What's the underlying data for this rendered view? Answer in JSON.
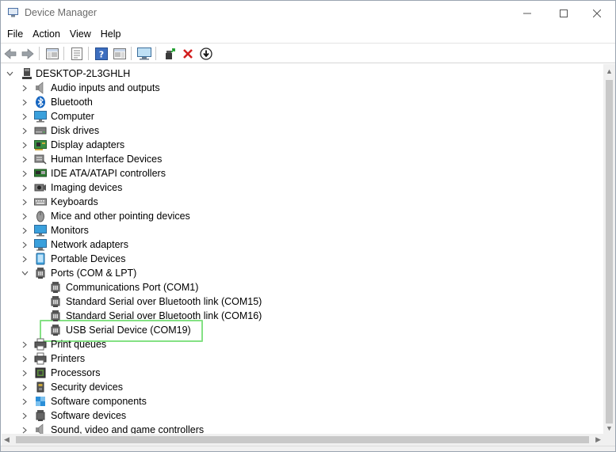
{
  "window": {
    "title": "Device Manager",
    "icon": "device-manager-icon"
  },
  "menu": [
    "File",
    "Action",
    "View",
    "Help"
  ],
  "toolbar": {
    "icons": [
      "back-arrow-icon",
      "forward-arrow-icon",
      "show-hide-console-tree-icon",
      "properties-icon",
      "help-icon",
      "action-pane-icon",
      "computer-monitor-icon",
      "update-driver-icon",
      "uninstall-device-icon",
      "disable-device-icon"
    ]
  },
  "tree": {
    "root": "DESKTOP-2L3GHLH",
    "categories": [
      {
        "label": "Audio inputs and outputs",
        "icon": "speaker-icon",
        "expanded": false
      },
      {
        "label": "Bluetooth",
        "icon": "bluetooth-icon",
        "expanded": false
      },
      {
        "label": "Computer",
        "icon": "computer-icon",
        "expanded": false
      },
      {
        "label": "Disk drives",
        "icon": "disk-drive-icon",
        "expanded": false
      },
      {
        "label": "Display adapters",
        "icon": "display-adapter-icon",
        "expanded": false
      },
      {
        "label": "Human Interface Devices",
        "icon": "hid-icon",
        "expanded": false
      },
      {
        "label": "IDE ATA/ATAPI controllers",
        "icon": "ide-controller-icon",
        "expanded": false
      },
      {
        "label": "Imaging devices",
        "icon": "camera-icon",
        "expanded": false
      },
      {
        "label": "Keyboards",
        "icon": "keyboard-icon",
        "expanded": false
      },
      {
        "label": "Mice and other pointing devices",
        "icon": "mouse-icon",
        "expanded": false
      },
      {
        "label": "Monitors",
        "icon": "monitor-icon",
        "expanded": false
      },
      {
        "label": "Network adapters",
        "icon": "network-adapter-icon",
        "expanded": false
      },
      {
        "label": "Portable Devices",
        "icon": "portable-device-icon",
        "expanded": false
      },
      {
        "label": "Ports (COM & LPT)",
        "icon": "port-icon",
        "expanded": true,
        "children": [
          "Communications Port (COM1)",
          "Standard Serial over Bluetooth link (COM15)",
          "Standard Serial over Bluetooth link (COM16)",
          "USB Serial Device (COM19)"
        ]
      },
      {
        "label": "Print queues",
        "icon": "printer-icon",
        "expanded": false
      },
      {
        "label": "Printers",
        "icon": "printer-icon",
        "expanded": false
      },
      {
        "label": "Processors",
        "icon": "processor-icon",
        "expanded": false
      },
      {
        "label": "Security devices",
        "icon": "security-device-icon",
        "expanded": false
      },
      {
        "label": "Software components",
        "icon": "software-component-icon",
        "expanded": false
      },
      {
        "label": "Software devices",
        "icon": "software-device-icon",
        "expanded": false
      },
      {
        "label": "Sound, video and game controllers",
        "icon": "sound-controller-icon",
        "expanded": false
      }
    ]
  },
  "highlighted_item": "USB Serial Device (COM19)",
  "highlight_color": "#84e184"
}
